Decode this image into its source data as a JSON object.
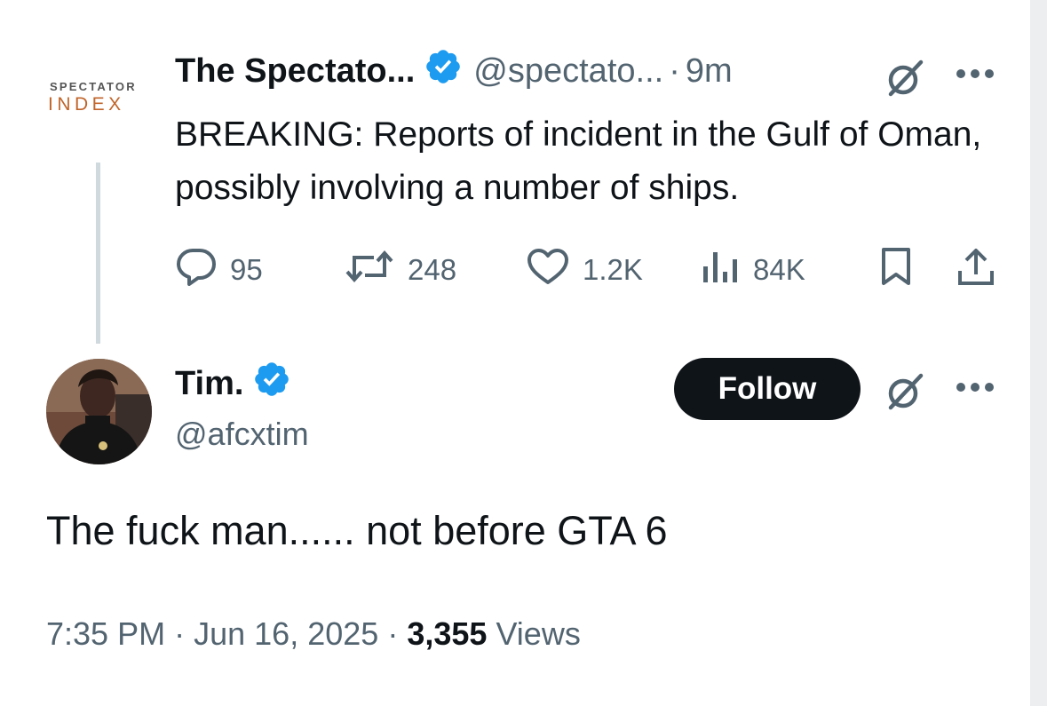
{
  "parent_tweet": {
    "avatar_line1": "SPECTATOR",
    "avatar_line2": "INDEX",
    "display_name": "The Spectato...",
    "handle": "@spectato...",
    "separator": "·",
    "time_ago": "9m",
    "text": "BREAKING: Reports of incident in the Gulf of Oman, possibly involving a number of ships.",
    "stats": {
      "replies": "95",
      "reposts": "248",
      "likes": "1.2K",
      "views": "84K"
    }
  },
  "main_tweet": {
    "display_name": "Tim.",
    "handle": "@afcxtim",
    "follow_label": "Follow",
    "text": "The fuck man...... not before GTA 6",
    "time": "7:35 PM",
    "sep": "·",
    "date": "Jun 16, 2025",
    "views_count": "3,355",
    "views_label": "Views"
  },
  "colors": {
    "verified": "#1d9bf0",
    "muted": "#536471",
    "text": "#0f1419",
    "logo_accent": "#c0652a"
  }
}
